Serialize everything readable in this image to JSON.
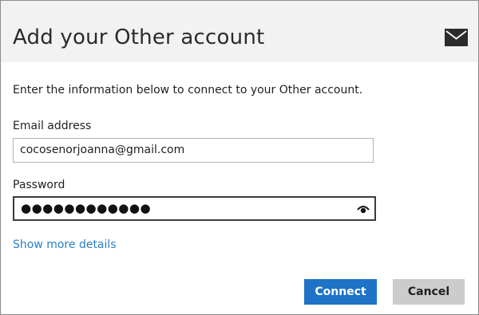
{
  "dialog": {
    "title": "Add your Other account",
    "intro": "Enter the information below to connect to your Other account.",
    "icon": "mail-icon"
  },
  "form": {
    "email_label": "Email address",
    "email_value": "cocosenorjoanna@gmail.com",
    "password_label": "Password",
    "password_masked": "●●●●●●●●●●●●",
    "reveal_icon": "eye-icon"
  },
  "links": {
    "show_more": "Show more details"
  },
  "buttons": {
    "connect": "Connect",
    "cancel": "Cancel"
  },
  "colors": {
    "header_bg": "#f2f2f2",
    "accent": "#1e73c6",
    "link": "#2a7fc7",
    "cancel_bg": "#cccccc"
  }
}
